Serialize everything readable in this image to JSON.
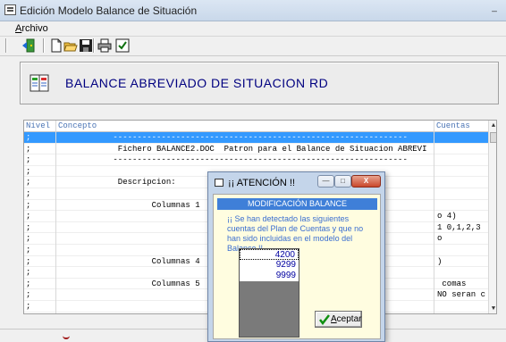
{
  "window": {
    "title": "Edición Modelo Balance de Situación",
    "minimize_glyph": "_"
  },
  "menu": {
    "items": [
      "Archivo"
    ]
  },
  "toolbar": {
    "buttons": [
      "exit-icon",
      "new-file-icon",
      "open-folder-icon",
      "save-icon",
      "print-icon",
      "checkbox-icon"
    ]
  },
  "header": {
    "title": "BALANCE ABREVIADO DE SITUACION RD",
    "icon": "ledger-book-icon"
  },
  "grid": {
    "columns": [
      "Nivel",
      "Concepto",
      "Cuentas"
    ],
    "rows": [
      {
        "nivel": ";",
        "concepto": "           -------------------------------------------------------------",
        "cuentas": ""
      },
      {
        "nivel": ";",
        "concepto": "            Fichero BALANCE2.DOC  Patron para el Balance de Situacion ABREVI",
        "cuentas": ""
      },
      {
        "nivel": ";",
        "concepto": "           -------------------------------------------------------------",
        "cuentas": ""
      },
      {
        "nivel": ";",
        "concepto": "",
        "cuentas": ""
      },
      {
        "nivel": ";",
        "concepto": "            Descripcion:",
        "cuentas": ""
      },
      {
        "nivel": ";",
        "concepto": "",
        "cuentas": ""
      },
      {
        "nivel": ";",
        "concepto": "                   Columnas 1",
        "cuentas": ""
      },
      {
        "nivel": ";",
        "concepto": "",
        "cuentas": "o 4)"
      },
      {
        "nivel": ";",
        "concepto": "",
        "cuentas": "1 0,1,2,3"
      },
      {
        "nivel": ";",
        "concepto": "",
        "cuentas": "o"
      },
      {
        "nivel": ";",
        "concepto": "",
        "cuentas": ""
      },
      {
        "nivel": ";",
        "concepto": "                   Columnas 4",
        "cuentas": ")"
      },
      {
        "nivel": ";",
        "concepto": "",
        "cuentas": ""
      },
      {
        "nivel": ";",
        "concepto": "                   Columnas 5",
        "cuentas": " comas"
      },
      {
        "nivel": ";",
        "concepto": "",
        "cuentas": "NO seran c"
      },
      {
        "nivel": ";",
        "concepto": "",
        "cuentas": ""
      },
      {
        "nivel": ";",
        "concepto": "",
        "cuentas": ""
      }
    ],
    "selected_row": 0,
    "scroll_up_glyph": "▲",
    "scroll_down_glyph": "▼"
  },
  "dialog": {
    "title": "¡¡ ATENCIÓN !!",
    "buttons": {
      "minimize": "—",
      "restore": "□",
      "close": "X"
    },
    "banner": "MODIFICACIÓN BALANCE",
    "message": "¡¡ Se han detectado las siguientes cuentas del Plan de Cuentas y que no han sido incluidas en el modelo del Balance !!",
    "accounts": [
      "4200",
      "9299",
      "9999"
    ],
    "accept_label": "Aceptar"
  },
  "colors": {
    "selection": "#3399ff",
    "header_title": "#000080",
    "banner": "#3f7fd8",
    "message": "#3a6ed0"
  }
}
